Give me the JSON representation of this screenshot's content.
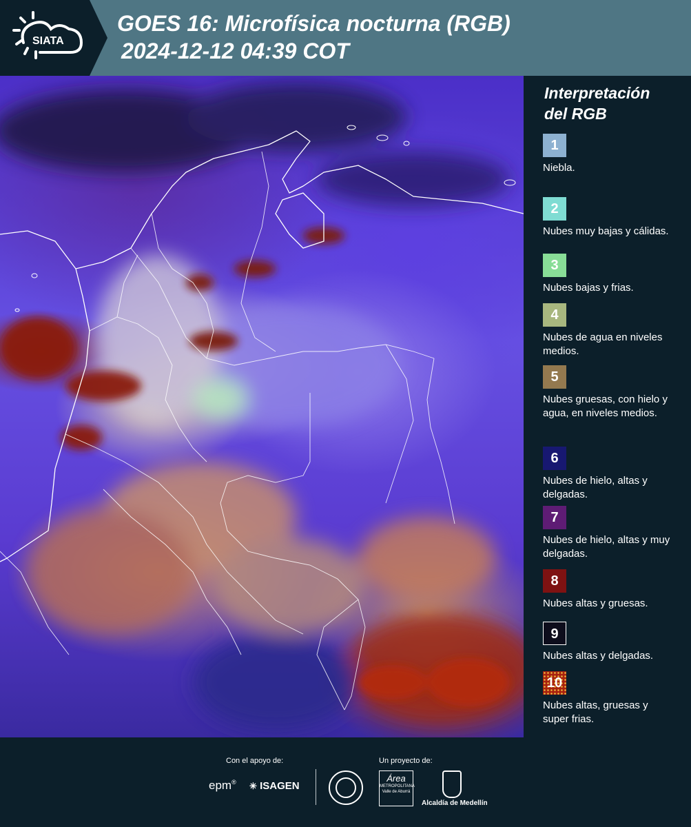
{
  "header": {
    "logo_text": "SIATA",
    "title_line1": "GOES 16: Microfísica nocturna (RGB)",
    "title_line2": "2024-12-12 04:39 COT"
  },
  "legend": {
    "title_line1": "Interpretación",
    "title_line2": "del RGB",
    "items": [
      {
        "number": "1",
        "label": "Niebla.",
        "color": "#8db1d1"
      },
      {
        "number": "2",
        "label": "Nubes muy bajas y cálidas.",
        "color": "#7fdcd3"
      },
      {
        "number": "3",
        "label": "Nubes bajas y frias.",
        "color": "#88dd97"
      },
      {
        "number": "4",
        "label": "Nubes de agua en niveles medios.",
        "color": "#a8b77f"
      },
      {
        "number": "5",
        "label": "Nubes gruesas, con hielo y agua, en niveles medios.",
        "color": "#94794f"
      },
      {
        "number": "6",
        "label": "Nubes de hielo, altas y delgadas.",
        "color": "#171871"
      },
      {
        "number": "7",
        "label": "Nubes de hielo, altas y muy delgadas.",
        "color": "#5e1c74"
      },
      {
        "number": "8",
        "label": "Nubes altas y gruesas.",
        "color": "#7e1212"
      },
      {
        "number": "9",
        "label": "Nubes altas y delgadas.",
        "color": "#0d0d1c"
      },
      {
        "number": "10",
        "label": "Nubes altas, gruesas y super frias.",
        "color": "#a8220f"
      }
    ]
  },
  "footer": {
    "support_label": "Con el apoyo de:",
    "project_label": "Un proyecto de:",
    "sponsor1": "epm",
    "sponsor1_mark": "®",
    "sponsor2": "ISAGEN",
    "partner_area": "Área",
    "partner_area_sub": "METROPOLITANA",
    "partner_area_sub2": "Valle de Aburrá",
    "partner_medellin": "Alcaldía de Medellín"
  }
}
